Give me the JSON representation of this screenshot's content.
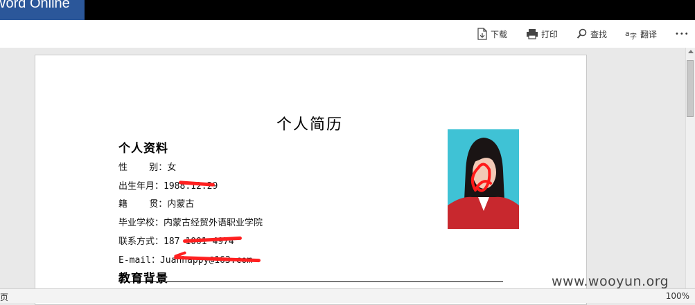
{
  "app": {
    "name": "Word Online"
  },
  "toolbar": {
    "download": "下载",
    "print": "打印",
    "find": "查找",
    "translate": "翻译",
    "more": "•••"
  },
  "document": {
    "title": "个人简历",
    "section_personal": "个人资料",
    "gender_label": "性    别：",
    "gender_value": "女",
    "birth_label": "出生年月：",
    "birth_value": "1988.12.29",
    "native_label": "籍    贯：",
    "native_value": "内蒙古",
    "school_label": "毕业学校：",
    "school_value": "内蒙古经贸外语职业学院",
    "contact_label": "联系方式：",
    "contact_value": "187 1001 4974",
    "email_label": "E-mail：",
    "email_value": "Juanhappy@163.com",
    "section_education": "教育背景"
  },
  "status": {
    "page_label": "页",
    "zoom": "100%"
  },
  "watermark": "www.wooyun.org"
}
